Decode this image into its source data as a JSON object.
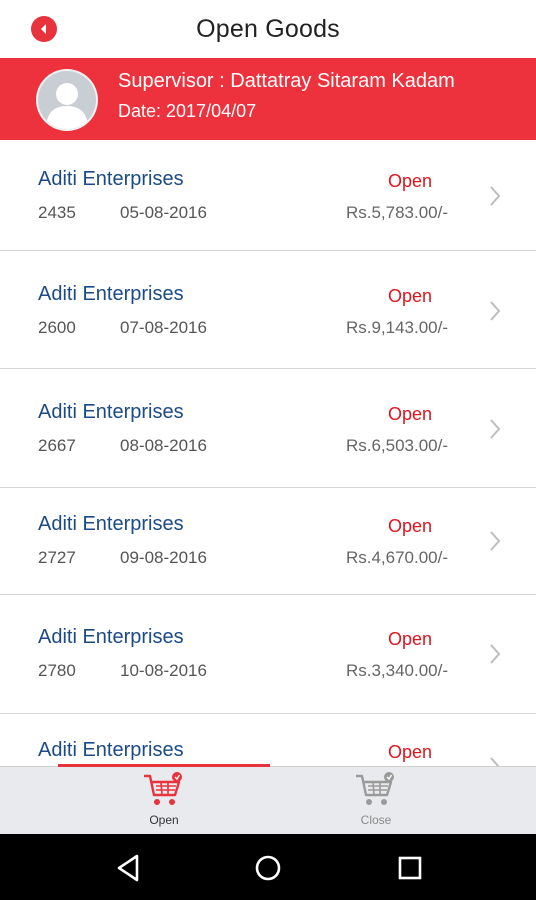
{
  "header": {
    "title": "Open Goods"
  },
  "supervisor": {
    "name_line": "Supervisor : Dattatray Sitaram Kadam",
    "date_line": "Date: 2017/04/07"
  },
  "orders": [
    {
      "party": "Aditi Enterprises",
      "number": "2435",
      "date": "05-08-2016",
      "status": "Open",
      "amount": "Rs.5,783.00/-"
    },
    {
      "party": "Aditi Enterprises",
      "number": "2600",
      "date": "07-08-2016",
      "status": "Open",
      "amount": "Rs.9,143.00/-"
    },
    {
      "party": "Aditi Enterprises",
      "number": "2667",
      "date": "08-08-2016",
      "status": "Open",
      "amount": "Rs.6,503.00/-"
    },
    {
      "party": "Aditi Enterprises",
      "number": "2727",
      "date": "09-08-2016",
      "status": "Open",
      "amount": "Rs.4,670.00/-"
    },
    {
      "party": "Aditi Enterprises",
      "number": "2780",
      "date": "10-08-2016",
      "status": "Open",
      "amount": "Rs.3,340.00/-"
    },
    {
      "party": "Aditi Enterprises",
      "number": "",
      "date": "",
      "status": "Open",
      "amount": ""
    }
  ],
  "tabs": [
    {
      "label": "Open",
      "icon": "cart-open-icon",
      "active": true
    },
    {
      "label": "Close",
      "icon": "cart-close-icon",
      "active": false
    }
  ],
  "colors": {
    "accent": "#ed323d",
    "party_text": "#1b4b86",
    "status_open": "#e0141d",
    "tab_inactive": "#9a9a9a"
  }
}
